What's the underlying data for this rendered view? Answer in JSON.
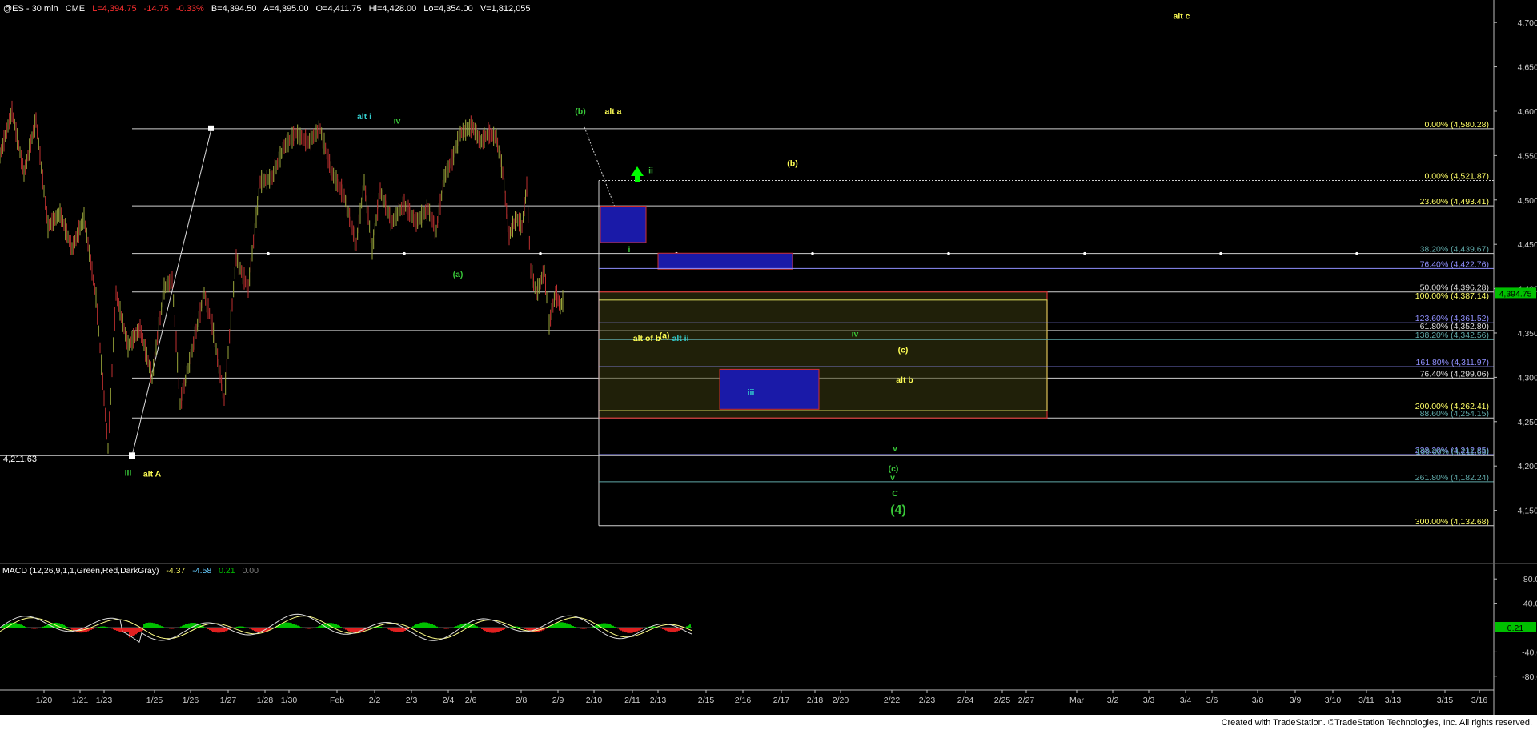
{
  "header": {
    "symbol": "@ES - 30 min",
    "exchange": "CME",
    "last": "L=4,394.75",
    "change": "-14.75",
    "change_pct": "-0.33%",
    "bid": "B=4,394.50",
    "ask": "A=4,395.00",
    "open": "O=4,411.75",
    "high": "Hi=4,428.00",
    "low": "Lo=4,354.00",
    "volume": "V=1,812,055"
  },
  "colors": {
    "background": "#000000",
    "up_bar": "#9aa63a",
    "down_bar": "#c03030",
    "grid": "#c8c8c8",
    "fib_white": "#e0e0e0",
    "fib_yellow": "#ffff66",
    "fib_blue": "#9090ff",
    "fib_teal": "#5fa8a8",
    "green_label": "#39c839",
    "cyan_label": "#33cccc",
    "yellow_label": "#ffff55",
    "box_blue": "#1a1aa8",
    "box_red": "#d03030",
    "macd_line": "#00c000",
    "macd_signal": "#ffff88",
    "macd_hist_pos": "#00c000",
    "macd_hist_neg": "#e02020",
    "last_price_tag": "#00c000"
  },
  "chart_data": {
    "type": "candlestick",
    "title": "@ES - 30 min",
    "ylim": [
      4100,
      4720
    ],
    "y_ticks": [
      "4,700.00",
      "4,650.00",
      "4,600.00",
      "4,550.00",
      "4,500.00",
      "4,450.00",
      "4,400.00",
      "4,350.00",
      "4,300.00",
      "4,250.00",
      "4,200.00",
      "4,150.00"
    ],
    "x_tick_labels": [
      "1/20",
      "1/21",
      "1/23",
      "1/25",
      "1/26",
      "1/27",
      "1/28",
      "1/30",
      "Feb",
      "2/2",
      "2/3",
      "2/4",
      "2/6",
      "2/8",
      "2/9",
      "2/10",
      "2/11",
      "2/13",
      "2/15",
      "2/16",
      "2/17",
      "2/18",
      "2/20",
      "2/22",
      "2/23",
      "2/24",
      "2/25",
      "2/27",
      "Mar",
      "3/2",
      "3/3",
      "3/4",
      "3/6",
      "3/8",
      "3/9",
      "3/10",
      "3/11",
      "3/13",
      "3/15",
      "3/16"
    ],
    "last_price_label": "4,394.75",
    "low_marker_label": "4,211.63",
    "price_path": [
      [
        0,
        4550
      ],
      [
        15,
        4600
      ],
      [
        30,
        4530
      ],
      [
        45,
        4590
      ],
      [
        60,
        4470
      ],
      [
        75,
        4485
      ],
      [
        90,
        4445
      ],
      [
        105,
        4480
      ],
      [
        120,
        4390
      ],
      [
        135,
        4220
      ],
      [
        145,
        4395
      ],
      [
        160,
        4335
      ],
      [
        175,
        4355
      ],
      [
        190,
        4300
      ],
      [
        205,
        4400
      ],
      [
        215,
        4410
      ],
      [
        225,
        4270
      ],
      [
        240,
        4330
      ],
      [
        255,
        4395
      ],
      [
        265,
        4360
      ],
      [
        280,
        4275
      ],
      [
        295,
        4435
      ],
      [
        310,
        4400
      ],
      [
        325,
        4520
      ],
      [
        340,
        4525
      ],
      [
        355,
        4560
      ],
      [
        370,
        4575
      ],
      [
        385,
        4565
      ],
      [
        400,
        4580
      ],
      [
        415,
        4530
      ],
      [
        430,
        4505
      ],
      [
        445,
        4450
      ],
      [
        455,
        4520
      ],
      [
        465,
        4445
      ],
      [
        475,
        4510
      ],
      [
        490,
        4475
      ],
      [
        505,
        4495
      ],
      [
        520,
        4475
      ],
      [
        535,
        4490
      ],
      [
        545,
        4465
      ],
      [
        555,
        4525
      ],
      [
        565,
        4545
      ],
      [
        575,
        4575
      ],
      [
        590,
        4583
      ],
      [
        600,
        4565
      ],
      [
        610,
        4575
      ],
      [
        620,
        4570
      ],
      [
        628,
        4530
      ],
      [
        636,
        4460
      ],
      [
        645,
        4480
      ],
      [
        652,
        4470
      ],
      [
        658,
        4515
      ],
      [
        663,
        4420
      ],
      [
        670,
        4395
      ],
      [
        680,
        4420
      ],
      [
        686,
        4360
      ],
      [
        694,
        4395
      ],
      [
        700,
        4380
      ],
      [
        706,
        4392
      ]
    ],
    "fib_levels": [
      {
        "label": "0.00% (4,580.28)",
        "value": 4580.28
      },
      {
        "label": "0.00% (4,521.87)",
        "value": 4521.87
      },
      {
        "label": "23.60% (4,493.41)",
        "value": 4493.41
      },
      {
        "label": "38.20% (4,439.67)",
        "value": 4439.67
      },
      {
        "label": "76.40% (4,422.76)",
        "value": 4422.76
      },
      {
        "label": "50.00% (4,396.28)",
        "value": 4396.28
      },
      {
        "label": "100.00% (4,387.14)",
        "value": 4387.14
      },
      {
        "label": "123.60% (4,361.52)",
        "value": 4361.52
      },
      {
        "label": "61.80% (4,352.80)",
        "value": 4352.8
      },
      {
        "label": "138.20% (4,342.56)",
        "value": 4342.56
      },
      {
        "label": "161.80% (4,311.97)",
        "value": 4311.97
      },
      {
        "label": "76.40% (4,299.06)",
        "value": 4299.06
      },
      {
        "label": "200.00% (4,262.41)",
        "value": 4262.41
      },
      {
        "label": "88.60% (4,254.15)",
        "value": 4254.15
      },
      {
        "label": "238.20% (4,212.85)",
        "value": 4212.85
      },
      {
        "label": "100.00% (4,211.63)",
        "value": 4211.63
      },
      {
        "label": "261.80% (4,182.24)",
        "value": 4182.24
      },
      {
        "label": "300.00% (4,132.68)",
        "value": 4132.68
      }
    ],
    "wave_labels": [
      {
        "text": "alt i",
        "price": 4591,
        "color": "cyan"
      },
      {
        "text": "iv",
        "price": 4586,
        "color": "green"
      },
      {
        "text": "(b)",
        "price": 4597,
        "color": "green"
      },
      {
        "text": "alt a",
        "price": 4597,
        "color": "yellow"
      },
      {
        "text": "alt c",
        "price": 4704,
        "color": "yellow"
      },
      {
        "text": "ii",
        "price": 4530,
        "color": "green"
      },
      {
        "text": "(b)",
        "price": 4538,
        "color": "yellow"
      },
      {
        "text": "i",
        "price": 4441,
        "color": "green"
      },
      {
        "text": "(a)",
        "price": 4413,
        "color": "green"
      },
      {
        "text": "alt of b",
        "price": 4341,
        "color": "yellow"
      },
      {
        "text": "(a)",
        "price": 4344,
        "color": "yellow"
      },
      {
        "text": "alt ii",
        "price": 4341,
        "color": "cyan"
      },
      {
        "text": "iv",
        "price": 4346,
        "color": "green"
      },
      {
        "text": "(c)",
        "price": 4328,
        "color": "yellow"
      },
      {
        "text": "alt b",
        "price": 4294,
        "color": "yellow"
      },
      {
        "text": "iii",
        "price": 4280,
        "color": "cyan"
      },
      {
        "text": "v",
        "price": 4217,
        "color": "green"
      },
      {
        "text": "(c)",
        "price": 4194,
        "color": "green"
      },
      {
        "text": "v",
        "price": 4184,
        "color": "green"
      },
      {
        "text": "C",
        "price": 4166,
        "color": "green"
      },
      {
        "text": "(4)",
        "price": 4146,
        "color": "green"
      },
      {
        "text": "iii",
        "price": 4189,
        "color": "green"
      },
      {
        "text": "alt A",
        "price": 4188,
        "color": "yellow"
      }
    ]
  },
  "macd": {
    "label": "MACD (12,26,9,1,1,Green,Red,DarkGray)",
    "value1": "-4.37",
    "value2": "-4.58",
    "value3": "0.21",
    "value4": "0.00",
    "y_ticks": [
      "80.00",
      "40.00",
      "-40.00",
      "-80.00"
    ],
    "last_value": "0.21",
    "ylim": [
      -100,
      100
    ]
  },
  "footer": {
    "credit": "Created with TradeStation. ©TradeStation Technologies, Inc. All rights reserved."
  }
}
